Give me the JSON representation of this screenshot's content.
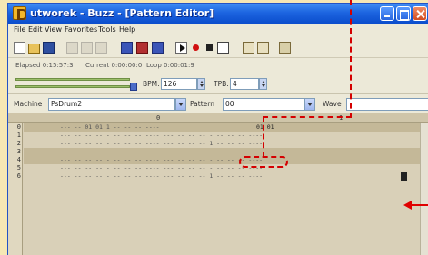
{
  "window": {
    "title": "utworek - Buzz - [Pattern Editor]"
  },
  "menu": [
    "File",
    "Edit",
    "View",
    "Favorites",
    "Tools",
    "Help"
  ],
  "info": {
    "elapsed": "Elapsed 0:15:57:3",
    "current": "Current 0:00:00:0",
    "loop": "Loop 0:00:01:9"
  },
  "tempo": {
    "bpm_label": "BPM:",
    "bpm_value": "126",
    "tpb_label": "TPB:",
    "tpb_value": "4"
  },
  "machine_bar": {
    "machine_label": "Machine",
    "machine_value": "PsDrum2",
    "pattern_label": "Pattern",
    "pattern_value": "00",
    "wave_label": "Wave",
    "wave_value": ""
  },
  "grid": {
    "columns": [
      "0",
      "1"
    ],
    "rows": [
      {
        "num": "0",
        "text": "--- -- 01 01 1 -- -- -- ---- ",
        "notes": "01 01"
      },
      {
        "num": "1",
        "text": "--- -- -- -- - -- -- -- ---- --- -- -- -- - -- -- -- ----",
        "notes": ""
      },
      {
        "num": "2",
        "text": "--- -- -- -- - -- -- -- ---- --- -- -- -- 1 -- -- -- ----",
        "notes": ""
      },
      {
        "num": "3",
        "text": "--- -- -- -- - -- -- -- ---- --- -- -- -- - -- -- -- ----",
        "notes": ""
      },
      {
        "num": "4",
        "text": "--- -- -- -- - -- -- -- ---- --- -- -- -- - -- -- -- ----",
        "notes": ""
      },
      {
        "num": "5",
        "text": "--- -- -- -- - -- -- -- ---- --- -- -- -- - -- -- -- ----",
        "notes": ""
      },
      {
        "num": "6",
        "text": "--- -- -- -- - -- -- -- ---- --- -- -- -- 1 -- -- -- ----",
        "notes": ""
      }
    ]
  },
  "colors": {
    "annotation": "#d40000",
    "title_bar": "#1c64e0",
    "background": "#f6e7b4"
  }
}
